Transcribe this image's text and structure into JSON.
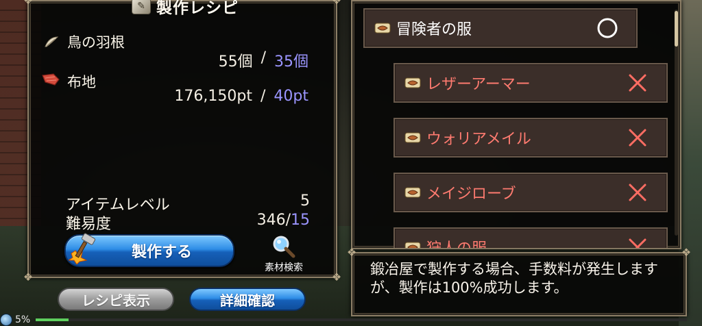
{
  "title": "製作レシピ",
  "materials": [
    {
      "name": "鳥の羽根",
      "icon": "feather-icon",
      "have": "55個",
      "need": "35個"
    },
    {
      "name": "布地",
      "icon": "cloth-icon",
      "have": "176,150pt",
      "need": "40pt"
    }
  ],
  "item_level": {
    "label": "アイテムレベル",
    "value": "5"
  },
  "difficulty": {
    "label": "難易度",
    "value": "346",
    "target": "15"
  },
  "buttons": {
    "craft": "製作する",
    "search": "素材検索",
    "recipe_display": "レシピ表示",
    "detail_confirm": "詳細確認"
  },
  "recipe_list": [
    {
      "name": "冒険者の服",
      "craftable": true
    },
    {
      "name": "レザーアーマー",
      "craftable": false
    },
    {
      "name": "ウォリアメイル",
      "craftable": false
    },
    {
      "name": "メイジローブ",
      "craftable": false
    },
    {
      "name": "狩人の服",
      "craftable": false
    }
  ],
  "message": "鍛冶屋で製作する場合、手数料が発生しますが、製作は100%成功します。",
  "hud": {
    "percent": "5%",
    "progress_fraction": 0.05
  },
  "colors": {
    "required_amount": "#9b95ff",
    "not_craftable_text": "#ff7b70",
    "not_craftable_mark": "#ff6d63",
    "craftable_mark": "#ffffff"
  }
}
